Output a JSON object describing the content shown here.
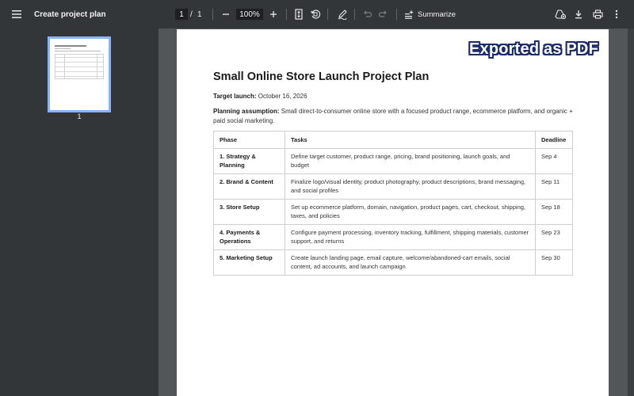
{
  "toolbar": {
    "title": "Create project plan",
    "page_current": "1",
    "page_separator": "/",
    "page_total": "1",
    "zoom": "100%",
    "summarize_label": "Summarize"
  },
  "sidebar": {
    "thumbnail_label": "1"
  },
  "stamp": {
    "text": "Exported as PDF"
  },
  "document": {
    "title": "Small Online Store Launch Project Plan",
    "target_launch_label": "Target launch:",
    "target_launch_value": " October 16, 2026",
    "assumption_label": "Planning assumption:",
    "assumption_value": " Small direct-to-consumer online store with a focused product range, ecommerce platform, and organic + paid social marketing.",
    "table": {
      "headers": [
        "Phase",
        "Tasks",
        "Deadline"
      ],
      "rows": [
        {
          "phase": "1. Strategy & Planning",
          "tasks": "Define target customer, product range, pricing, brand positioning, launch goals, and budget",
          "deadline": "Sep 4"
        },
        {
          "phase": "2. Brand & Content",
          "tasks": "Finalize logo/visual identity, product photography, product descriptions, brand messaging, and social profiles",
          "deadline": "Sep 11"
        },
        {
          "phase": "3. Store Setup",
          "tasks": "Set up ecommerce platform, domain, navigation, product pages, cart, checkout, shipping, taxes, and policies",
          "deadline": "Sep 18"
        },
        {
          "phase": "4. Payments & Operations",
          "tasks": "Configure payment processing, inventory tracking, fulfillment, shipping materials, customer support, and returns",
          "deadline": "Sep 23"
        },
        {
          "phase": "5. Marketing Setup",
          "tasks": "Create launch landing page, email capture, welcome/abandoned-cart emails, social content, ad accounts, and launch campaign",
          "deadline": "Sep 30"
        }
      ]
    }
  },
  "colors": {
    "toolbar_bg": "#323639",
    "viewer_bg": "#525659",
    "thumbnail_highlight": "#8ab4f8",
    "stamp_outline": "#1b2b67"
  },
  "icons": {
    "menu": "hamburger-menu-icon",
    "zoom_out": "minus-icon",
    "zoom_in": "plus-icon",
    "fit": "fit-page-icon",
    "rotate": "rotate-icon",
    "annotate": "pen-icon",
    "undo": "undo-icon",
    "redo": "redo-icon",
    "summarize": "sparkle-icon",
    "drive": "drive-add-icon",
    "download": "download-icon",
    "print": "print-icon",
    "more": "more-vert-icon"
  }
}
